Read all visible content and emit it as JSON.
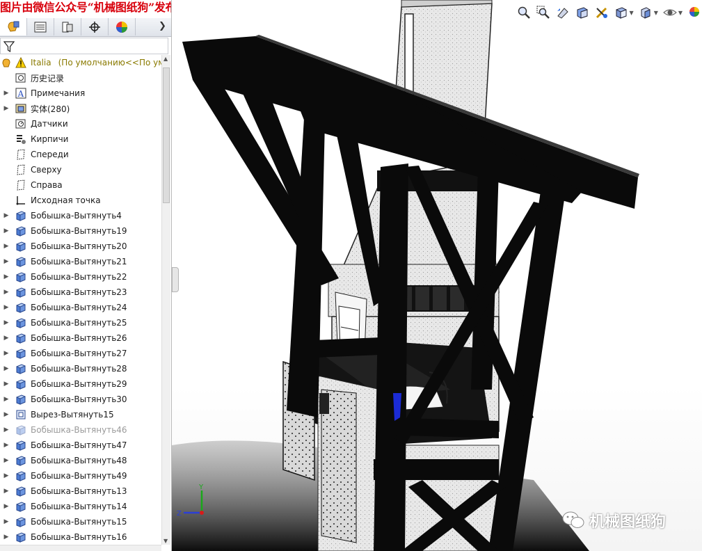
{
  "watermark": {
    "top_text": "图片由微信公众号“机械图纸狗”发布",
    "bottom_text": "机械图纸狗"
  },
  "panel_tabs": [
    {
      "name": "feature-manager",
      "icon": "feature-manager-icon"
    },
    {
      "name": "property-manager",
      "icon": "property-manager-icon"
    },
    {
      "name": "configuration-manager",
      "icon": "configuration-manager-icon"
    },
    {
      "name": "dimxpert-manager",
      "icon": "dimxpert-icon"
    },
    {
      "name": "display-manager",
      "icon": "display-manager-icon"
    }
  ],
  "tree": {
    "root": {
      "label": "Italia",
      "config": "(По умолчанию<<По ум"
    },
    "items": [
      {
        "label": "历史记录",
        "icon": "history-icon",
        "expandable": false,
        "gray": false
      },
      {
        "label": "Примечания",
        "icon": "annotations-icon",
        "expandable": true,
        "gray": false
      },
      {
        "label": "实体(280)",
        "icon": "solid-bodies-icon",
        "expandable": true,
        "gray": false
      },
      {
        "label": "Датчики",
        "icon": "sensors-icon",
        "expandable": false,
        "gray": false
      },
      {
        "label": "Кирпичи",
        "icon": "material-icon",
        "expandable": false,
        "gray": false
      },
      {
        "label": "Спереди",
        "icon": "plane-icon",
        "expandable": false,
        "gray": false
      },
      {
        "label": "Сверху",
        "icon": "plane-icon",
        "expandable": false,
        "gray": false
      },
      {
        "label": "Справа",
        "icon": "plane-icon",
        "expandable": false,
        "gray": false
      },
      {
        "label": "Исходная точка",
        "icon": "origin-icon",
        "expandable": false,
        "gray": false
      },
      {
        "label": "Бобышка-Вытянуть4",
        "icon": "extrude-icon",
        "expandable": true,
        "gray": false
      },
      {
        "label": "Бобышка-Вытянуть19",
        "icon": "extrude-icon",
        "expandable": true,
        "gray": false
      },
      {
        "label": "Бобышка-Вытянуть20",
        "icon": "extrude-icon",
        "expandable": true,
        "gray": false
      },
      {
        "label": "Бобышка-Вытянуть21",
        "icon": "extrude-icon",
        "expandable": true,
        "gray": false
      },
      {
        "label": "Бобышка-Вытянуть22",
        "icon": "extrude-icon",
        "expandable": true,
        "gray": false
      },
      {
        "label": "Бобышка-Вытянуть23",
        "icon": "extrude-icon",
        "expandable": true,
        "gray": false
      },
      {
        "label": "Бобышка-Вытянуть24",
        "icon": "extrude-icon",
        "expandable": true,
        "gray": false
      },
      {
        "label": "Бобышка-Вытянуть25",
        "icon": "extrude-icon",
        "expandable": true,
        "gray": false
      },
      {
        "label": "Бобышка-Вытянуть26",
        "icon": "extrude-icon",
        "expandable": true,
        "gray": false
      },
      {
        "label": "Бобышка-Вытянуть27",
        "icon": "extrude-icon",
        "expandable": true,
        "gray": false
      },
      {
        "label": "Бобышка-Вытянуть28",
        "icon": "extrude-icon",
        "expandable": true,
        "gray": false
      },
      {
        "label": "Бобышка-Вытянуть29",
        "icon": "extrude-icon",
        "expandable": true,
        "gray": false
      },
      {
        "label": "Бобышка-Вытянуть30",
        "icon": "extrude-icon",
        "expandable": true,
        "gray": false
      },
      {
        "label": "Вырез-Вытянуть15",
        "icon": "cut-extrude-icon",
        "expandable": true,
        "gray": false
      },
      {
        "label": "Бобышка-Вытянуть46",
        "icon": "extrude-icon",
        "expandable": true,
        "gray": true
      },
      {
        "label": "Бобышка-Вытянуть47",
        "icon": "extrude-icon",
        "expandable": true,
        "gray": false
      },
      {
        "label": "Бобышка-Вытянуть48",
        "icon": "extrude-icon",
        "expandable": true,
        "gray": false
      },
      {
        "label": "Бобышка-Вытянуть49",
        "icon": "extrude-icon",
        "expandable": true,
        "gray": false
      },
      {
        "label": "Бобышка-Вытянуть13",
        "icon": "extrude-icon",
        "expandable": true,
        "gray": false
      },
      {
        "label": "Бобышка-Вытянуть14",
        "icon": "extrude-icon",
        "expandable": true,
        "gray": false
      },
      {
        "label": "Бобышка-Вытянуть15",
        "icon": "extrude-icon",
        "expandable": true,
        "gray": false
      },
      {
        "label": "Бобышка-Вытянуть16",
        "icon": "extrude-icon",
        "expandable": true,
        "gray": false
      }
    ]
  },
  "toolbar": [
    {
      "name": "zoom-to-fit",
      "icon": "zoom-fit-icon"
    },
    {
      "name": "zoom-to-area",
      "icon": "zoom-area-icon"
    },
    {
      "name": "previous-view",
      "icon": "previous-view-icon"
    },
    {
      "name": "section-view",
      "icon": "section-view-icon"
    },
    {
      "name": "dynamic-annotation",
      "icon": "annotation-view-icon"
    },
    {
      "name": "view-orientation",
      "icon": "view-orientation-icon",
      "dropdown": true
    },
    {
      "name": "display-style",
      "icon": "display-style-icon",
      "dropdown": true
    },
    {
      "name": "hide-show",
      "icon": "hide-show-icon",
      "dropdown": true
    },
    {
      "name": "appearance",
      "icon": "appearance-icon"
    }
  ],
  "triad": {
    "x": "",
    "y": "Y",
    "z": "Z"
  },
  "colors": {
    "accent_tab": "#ffffff",
    "watermark_red": "#d8000c",
    "model_black": "#0a0a0a",
    "model_gray": "#e9e9e9"
  }
}
